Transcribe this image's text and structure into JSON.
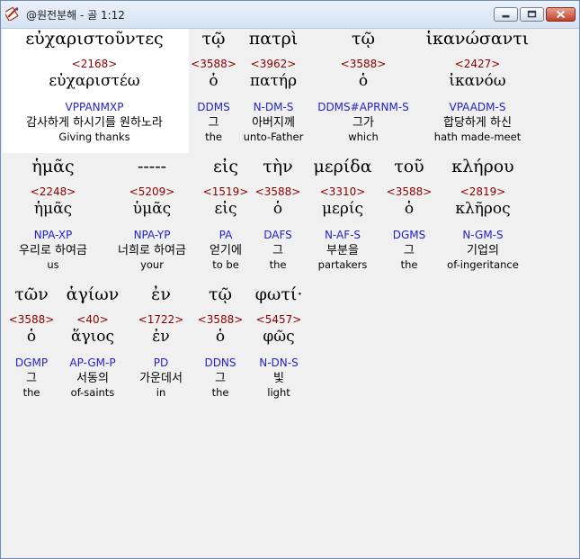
{
  "window": {
    "title": "@원전분해 - 골 1:12",
    "controls": {
      "minimize": "minimize",
      "maximize": "maximize",
      "close": "close"
    }
  },
  "verse": {
    "rows": [
      [
        {
          "greek": "εὐχαριστοῦντες",
          "strong": "<2168>",
          "lemma": "εὐχαριστέω",
          "parse": "VPPANMXP",
          "korean": "감사하게 하시기를 원하노라",
          "english": "Giving thanks"
        },
        {
          "greek": "τῷ",
          "strong": "<3588>",
          "lemma": "ὁ",
          "parse": "DDMS",
          "korean": "그",
          "english": "the"
        },
        {
          "greek": "πατρὶ",
          "strong": "<3962>",
          "lemma": "πατήρ",
          "parse": "N-DM-S",
          "korean": "아버지께",
          "english": "unto-Father"
        },
        {
          "greek": "τῷ",
          "strong": "<3588>",
          "lemma": "ὁ",
          "parse": "DDMS#APRNM-S",
          "korean": "그가",
          "english": "which"
        },
        {
          "greek": "ἱκανώσαντι",
          "strong": "<2427>",
          "lemma": "ἱκανόω",
          "parse": "VPAADM-S",
          "korean": "합당하게 하신",
          "english": "hath made-meet"
        }
      ],
      [
        {
          "greek": "ἡμᾶς",
          "strong": "<2248>",
          "lemma": "ἡμᾶς",
          "parse": "NPA-XP",
          "korean": "우리로 하여금",
          "english": "us"
        },
        {
          "greek": "-----",
          "strong": "<5209>",
          "lemma": "ὑμᾶς",
          "parse": "NPA-YP",
          "korean": "너희로 하여금",
          "english": "your"
        },
        {
          "greek": "εἰς",
          "strong": "<1519>",
          "lemma": "εἰς",
          "parse": "PA",
          "korean": "얻기에",
          "english": "to be"
        },
        {
          "greek": "τὴν",
          "strong": "<3588>",
          "lemma": "ὁ",
          "parse": "DAFS",
          "korean": "그",
          "english": "the"
        },
        {
          "greek": "μερίδα",
          "strong": "<3310>",
          "lemma": "μερίς",
          "parse": "N-AF-S",
          "korean": "부분을",
          "english": "partakers"
        },
        {
          "greek": "τοῦ",
          "strong": "<3588>",
          "lemma": "ὁ",
          "parse": "DGMS",
          "korean": "그",
          "english": "the"
        },
        {
          "greek": "κλήρου",
          "strong": "<2819>",
          "lemma": "κλῆρος",
          "parse": "N-GM-S",
          "korean": "기업의",
          "english": "of-ingeritance"
        }
      ],
      [
        {
          "greek": "τῶν",
          "strong": "<3588>",
          "lemma": "ὁ",
          "parse": "DGMP",
          "korean": "그",
          "english": "the"
        },
        {
          "greek": "ἁγίων",
          "strong": "<40>",
          "lemma": "ἅγιος",
          "parse": "AP-GM-P",
          "korean": "서동의",
          "english": "of-saints"
        },
        {
          "greek": "ἐν",
          "strong": "<1722>",
          "lemma": "ἐν",
          "parse": "PD",
          "korean": "가운데서",
          "english": "in"
        },
        {
          "greek": "τῷ",
          "strong": "<3588>",
          "lemma": "ὁ",
          "parse": "DDNS",
          "korean": "그",
          "english": "the"
        },
        {
          "greek": "φωτί·",
          "strong": "<5457>",
          "lemma": "φῶς",
          "parse": "N-DN-S",
          "korean": "빛",
          "english": "light"
        }
      ]
    ]
  }
}
